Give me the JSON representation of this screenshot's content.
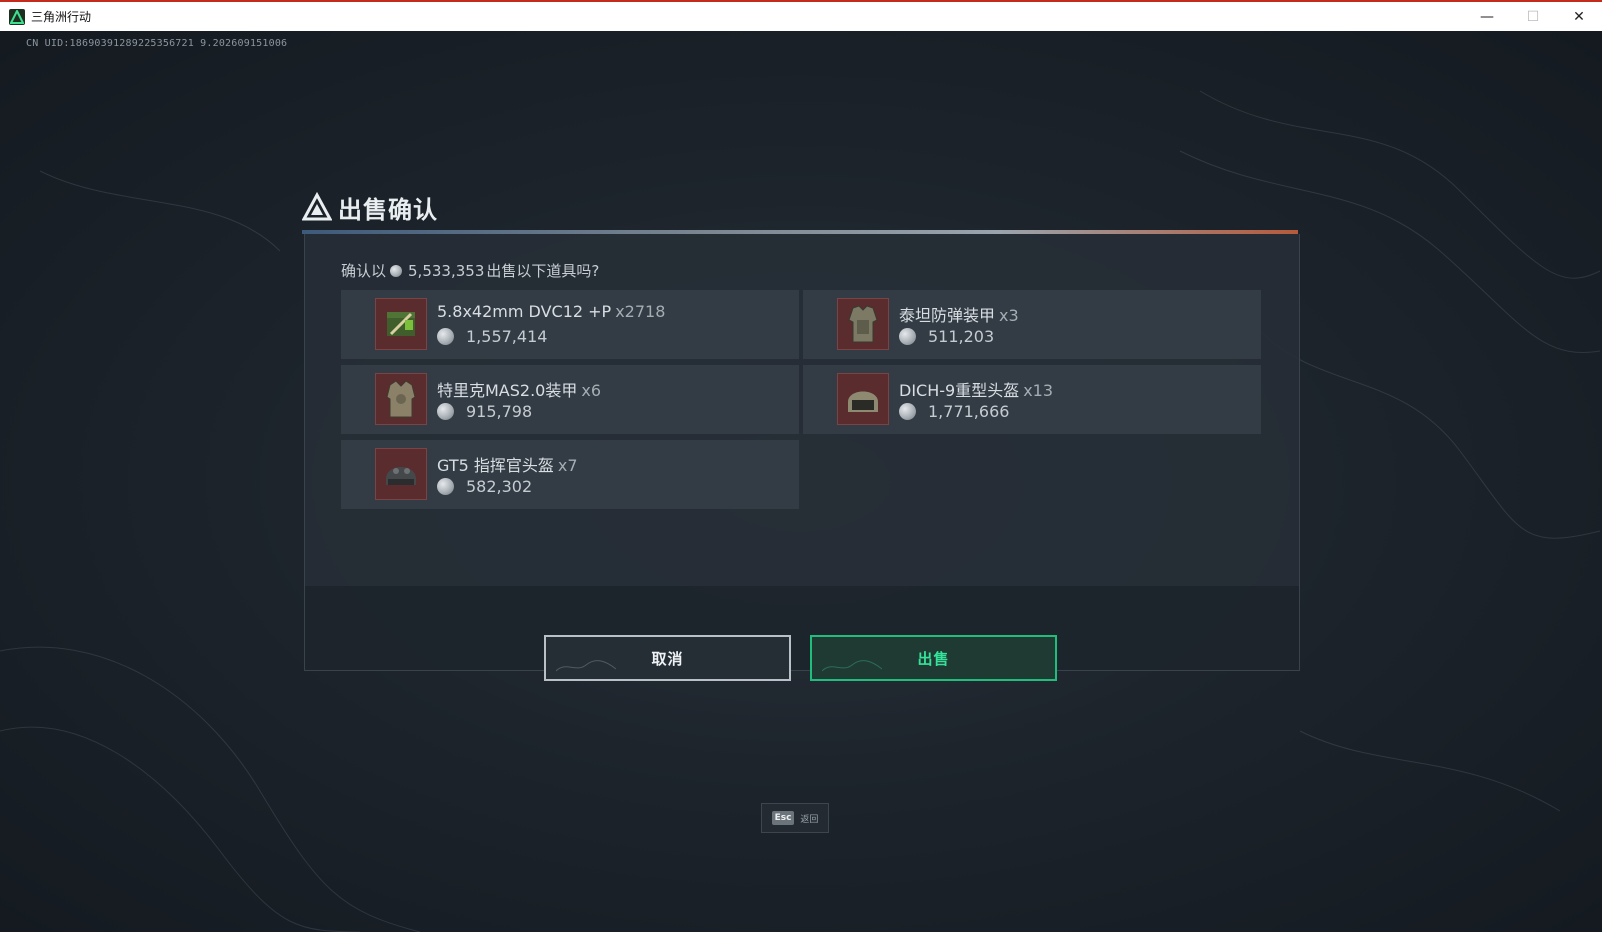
{
  "window": {
    "title": "三角洲行动",
    "minimize_glyph": "—",
    "maximize_glyph": "☐",
    "close_glyph": "✕"
  },
  "uid_text": "CN UID:18690391289225356721 9.202609151006",
  "dialog": {
    "title": "出售确认",
    "prompt_prefix": "确认以",
    "prompt_amount": "5,533,353",
    "prompt_suffix": "出售以下道具吗?",
    "items": [
      {
        "name": "5.8x42mm DVC12 +P",
        "qty": "x2718",
        "price": "1,557,414",
        "icon": "ammo-box-icon"
      },
      {
        "name": "泰坦防弹装甲",
        "qty": "x3",
        "price": "511,203",
        "icon": "body-armor-icon"
      },
      {
        "name": "特里克MAS2.0装甲",
        "qty": "x6",
        "price": "915,798",
        "icon": "body-armor-icon"
      },
      {
        "name": "DICH-9重型头盔",
        "qty": "x13",
        "price": "1,771,666",
        "icon": "heavy-helmet-icon"
      },
      {
        "name": "GT5 指挥官头盔",
        "qty": "x7",
        "price": "582,302",
        "icon": "commander-helmet-icon"
      }
    ],
    "cancel_label": "取消",
    "sell_label": "出售"
  },
  "esc_hint": {
    "key": "Esc",
    "label": "返回"
  },
  "colors": {
    "accent_green": "#36e29a",
    "item_thumb_bg": "#5a2c2e",
    "titlebar_accent": "#c42b1c"
  }
}
